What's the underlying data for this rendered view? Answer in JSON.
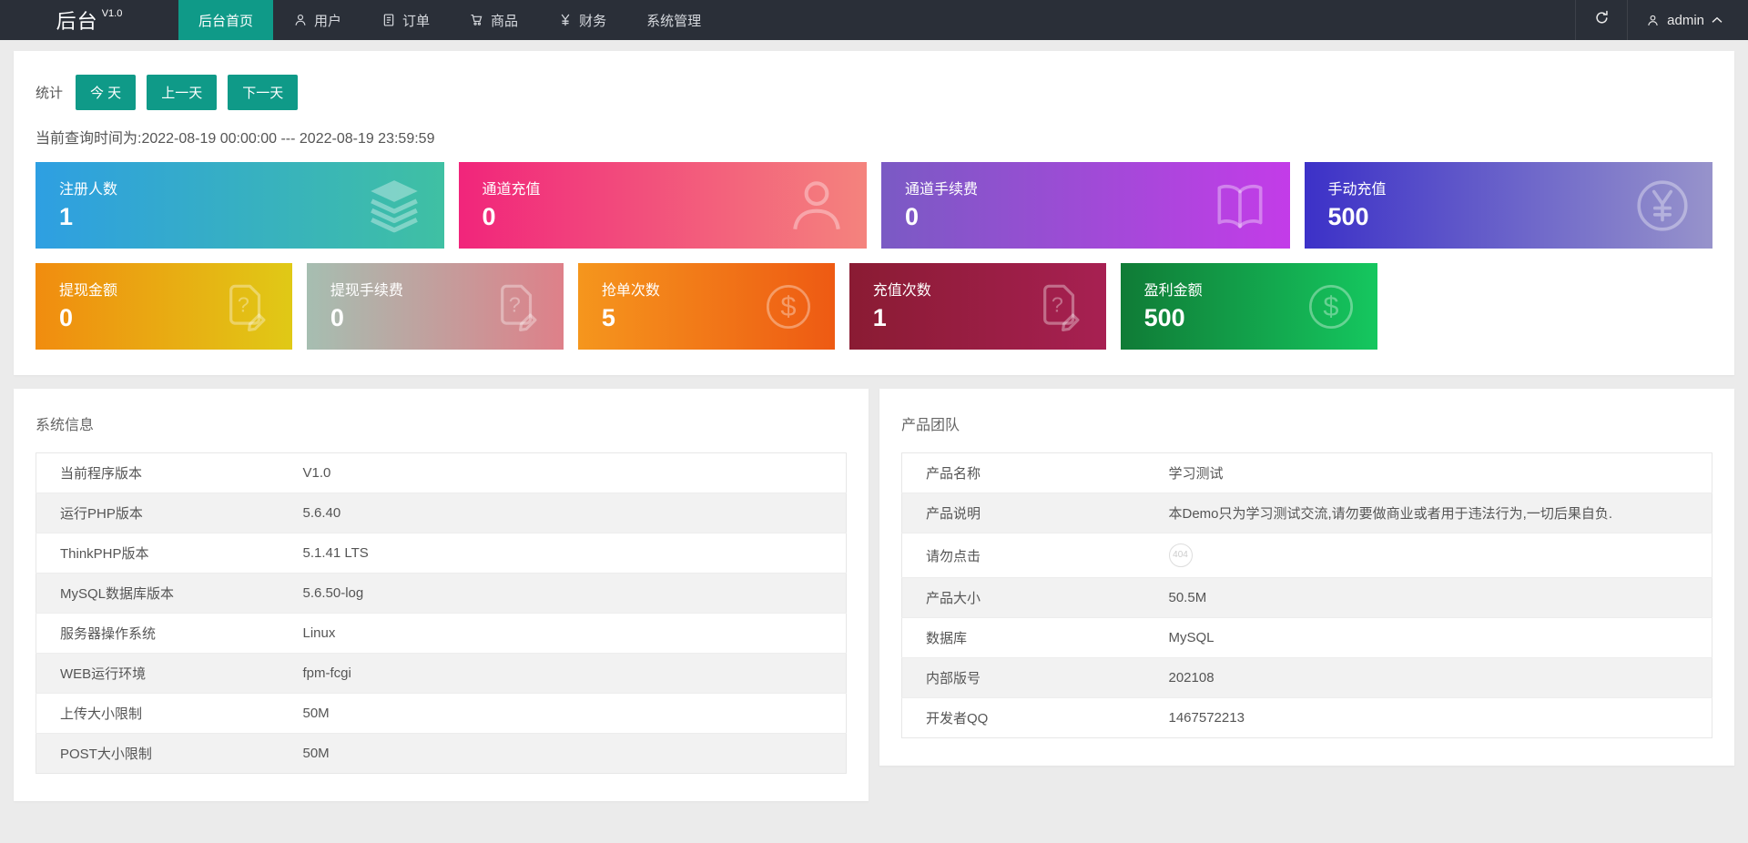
{
  "navbar": {
    "brand": "后台",
    "version": "V1.0",
    "items": [
      {
        "label": "后台首页",
        "icon": null,
        "active": true
      },
      {
        "label": "用户",
        "icon": "user-icon",
        "active": false
      },
      {
        "label": "订单",
        "icon": "order-icon",
        "active": false
      },
      {
        "label": "商品",
        "icon": "cart-icon",
        "active": false
      },
      {
        "label": "财务",
        "icon": "yen-icon",
        "active": false
      },
      {
        "label": "系统管理",
        "icon": null,
        "active": false
      }
    ],
    "refresh_icon": "refresh-icon",
    "user_name": "admin",
    "colors": {
      "bg": "#2a2f38",
      "active": "#0f9a88"
    }
  },
  "stats": {
    "label": "统计",
    "buttons": [
      "今 天",
      "上一天",
      "下一天"
    ],
    "query_time": "当前查询时间为:2022-08-19 00:00:00 --- 2022-08-19 23:59:59",
    "accent": "#0f9a88"
  },
  "stat_cards_row1": [
    {
      "label": "注册人数",
      "value": "1",
      "icon": "layers-icon",
      "gradient": [
        "#2e9fe2",
        "#3fc0a3"
      ]
    },
    {
      "label": "通道充值",
      "value": "0",
      "icon": "person-icon",
      "gradient": [
        "#f1257b",
        "#f4837d"
      ]
    },
    {
      "label": "通道手续费",
      "value": "0",
      "icon": "book-icon",
      "gradient": [
        "#7a5ac4",
        "#c33ce8"
      ]
    },
    {
      "label": "手动充值",
      "value": "500",
      "icon": "yen-circle-icon",
      "gradient": [
        "#3c31c8",
        "#9793cb"
      ]
    }
  ],
  "stat_cards_row2": [
    {
      "label": "提现金额",
      "value": "0",
      "icon": "file-question-icon",
      "gradient": [
        "#f18c0f",
        "#e0c916"
      ]
    },
    {
      "label": "提现手续费",
      "value": "0",
      "icon": "file-question-icon",
      "gradient": [
        "#a6beb1",
        "#de8089"
      ]
    },
    {
      "label": "抢单次数",
      "value": "5",
      "icon": "dollar-circle-icon",
      "gradient": [
        "#f5961d",
        "#ee5a13"
      ]
    },
    {
      "label": "充值次数",
      "value": "1",
      "icon": "file-question-icon",
      "gradient": [
        "#8a1b33",
        "#a72052"
      ]
    },
    {
      "label": "盈利金额",
      "value": "500",
      "icon": "dollar-circle-icon",
      "gradient": [
        "#107b36",
        "#15c75f"
      ]
    }
  ],
  "system_panel": {
    "title": "系统信息",
    "rows": [
      {
        "label": "当前程序版本",
        "value": "V1.0"
      },
      {
        "label": "运行PHP版本",
        "value": "5.6.40"
      },
      {
        "label": "ThinkPHP版本",
        "value": "5.1.41 LTS"
      },
      {
        "label": "MySQL数据库版本",
        "value": "5.6.50-log"
      },
      {
        "label": "服务器操作系统",
        "value": "Linux"
      },
      {
        "label": "WEB运行环境",
        "value": "fpm-fcgi"
      },
      {
        "label": "上传大小限制",
        "value": "50M"
      },
      {
        "label": "POST大小限制",
        "value": "50M"
      }
    ]
  },
  "product_panel": {
    "title": "产品团队",
    "rows": [
      {
        "label": "产品名称",
        "value": "学习测试"
      },
      {
        "label": "产品说明",
        "value": "本Demo只为学习测试交流,请勿要做商业或者用于违法行为,一切后果自负."
      },
      {
        "label": "请勿点击",
        "value": "404",
        "type": "badge"
      },
      {
        "label": "产品大小",
        "value": "50.5M"
      },
      {
        "label": "数据库",
        "value": "MySQL"
      },
      {
        "label": "内部版号",
        "value": "202108"
      },
      {
        "label": "开发者QQ",
        "value": "1467572213"
      }
    ]
  }
}
